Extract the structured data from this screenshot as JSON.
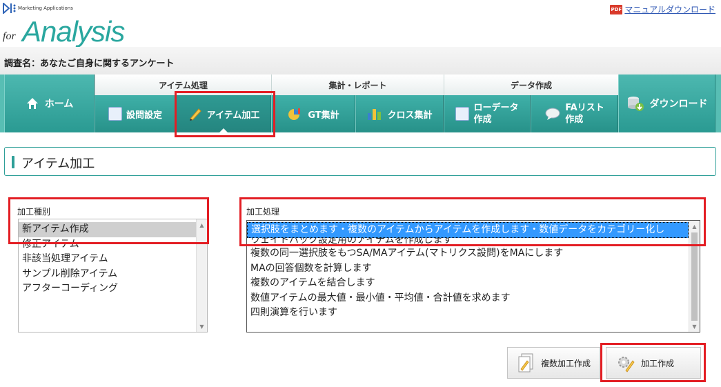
{
  "header": {
    "logo_small": "Marketing Applications",
    "logo_for": "for",
    "logo_main": "Analysis",
    "manual_pdf": "PDF",
    "manual_link": "マニュアルダウンロード"
  },
  "survey": {
    "title": "調査名：あなたご自身に関するアンケート"
  },
  "nav": {
    "home": "ホーム",
    "group_item": "アイテム処理",
    "group_report": "集計・レポート",
    "group_data": "データ作成",
    "setup": "設問設定",
    "item_edit": "アイテム加工",
    "gt": "GT集計",
    "cross": "クロス集計",
    "rawdata_1": "ローデータ",
    "rawdata_2": "作成",
    "fa_1": "FAリスト",
    "fa_2": "作成",
    "download": "ダウンロード"
  },
  "section": {
    "title": "アイテム加工"
  },
  "type_panel": {
    "label": "加工種別",
    "items": [
      "新アイテム作成",
      "修正アイテム",
      "非該当処理アイテム",
      "サンプル削除アイテム",
      "アフターコーディング"
    ],
    "selected": "新アイテム作成"
  },
  "process_panel": {
    "label": "加工処理",
    "items": [
      "選択肢をまとめます・複数のアイテムからアイテムを作成します・数値データをカテゴリー化し",
      "ウェイトバック設定用のアイテムを作成します",
      "複数の同一選択肢をもつSA/MAアイテム(マトリクス設問)をMAにします",
      "MAの回答個数を計算します",
      "複数のアイテムを結合します",
      "数値アイテムの最大値・最小値・平均値・合計値を求めます",
      "四則演算を行います"
    ],
    "selected": "選択肢をまとめます・複数のアイテムからアイテムを作成します・数値データをカテゴリー化し"
  },
  "buttons": {
    "multi_create": "複数加工作成",
    "create": "加工作成"
  },
  "colors": {
    "accent": "#2e9f98",
    "highlight": "#e31e24",
    "selection": "#3399ff"
  }
}
